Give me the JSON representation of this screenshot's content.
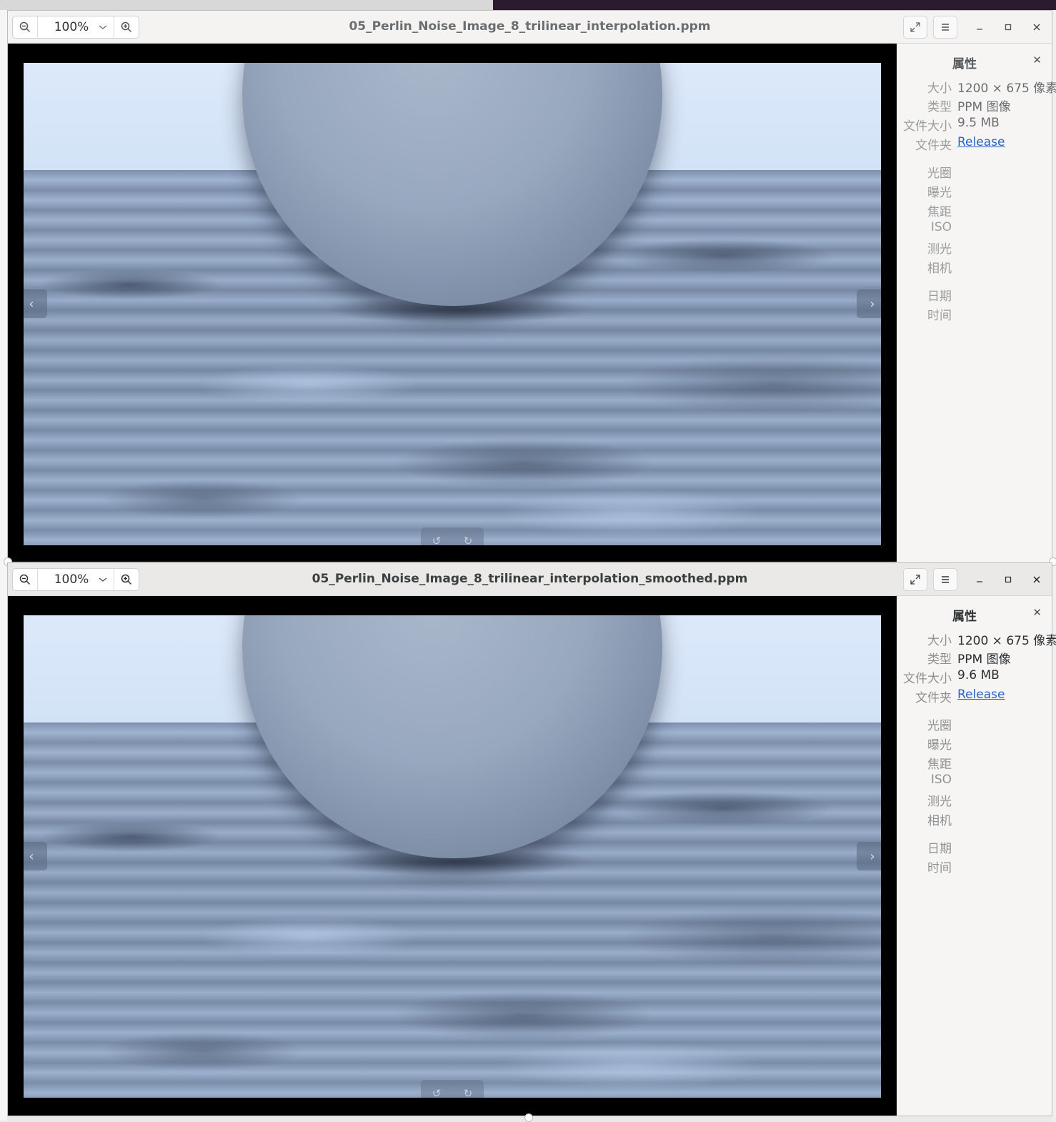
{
  "windows": [
    {
      "zoom": "100%",
      "title": "05_Perlin_Noise_Image_8_trilinear_interpolation.ppm",
      "properties": {
        "heading": "属性",
        "rows": [
          {
            "key": "大小",
            "value": "1200 × 675 像素"
          },
          {
            "key": "类型",
            "value": "PPM 图像"
          },
          {
            "key": "文件大小",
            "value": "9.5 MB"
          },
          {
            "key": "文件夹",
            "value": "Release"
          }
        ],
        "exif_keys": [
          "光圈",
          "曝光",
          "焦距",
          "ISO",
          "测光",
          "相机"
        ],
        "date_keys": [
          "日期",
          "时间"
        ]
      }
    },
    {
      "zoom": "100%",
      "title": "05_Perlin_Noise_Image_8_trilinear_interpolation_smoothed.ppm",
      "properties": {
        "heading": "属性",
        "rows": [
          {
            "key": "大小",
            "value": "1200 × 675 像素"
          },
          {
            "key": "类型",
            "value": "PPM 图像"
          },
          {
            "key": "文件大小",
            "value": "9.6 MB"
          },
          {
            "key": "文件夹",
            "value": "Release"
          }
        ],
        "exif_keys": [
          "光圈",
          "曝光",
          "焦距",
          "ISO",
          "测光",
          "相机"
        ],
        "date_keys": [
          "日期",
          "时间"
        ]
      }
    }
  ],
  "icons": {
    "zoom_out": "zoom-out-icon",
    "zoom_in": "zoom-in-icon",
    "fullscreen": "fullscreen-icon",
    "menu": "hamburger-menu-icon",
    "minimize": "minimize-icon",
    "maximize": "maximize-icon",
    "close": "close-icon",
    "prev": "chevron-left-icon",
    "next": "chevron-right-icon",
    "rotate_left": "rotate-left-icon",
    "rotate_right": "rotate-right-icon"
  },
  "colors": {
    "link": "#2a62c9",
    "header_bg": "#f4f3f2",
    "viewer_bg": "#000000"
  }
}
